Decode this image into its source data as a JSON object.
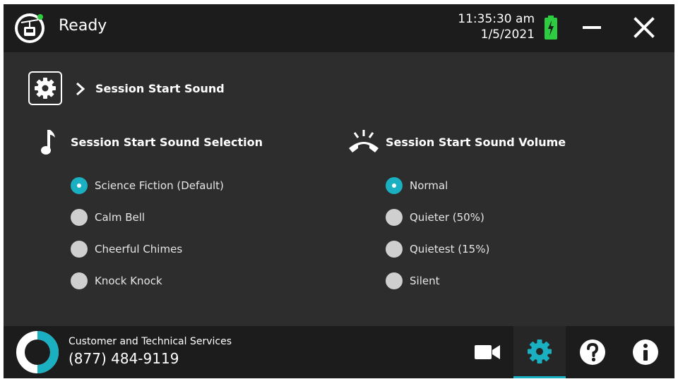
{
  "header": {
    "status": "Ready",
    "time": "11:35:30 am",
    "date": "1/5/2021",
    "battery_icon": "battery-charging-icon"
  },
  "breadcrumb": {
    "title": "Session Start Sound"
  },
  "sound_selection": {
    "title": "Session Start Sound Selection",
    "options": [
      {
        "label": "Science Fiction (Default)",
        "selected": true
      },
      {
        "label": "Calm Bell",
        "selected": false
      },
      {
        "label": "Cheerful Chimes",
        "selected": false
      },
      {
        "label": "Knock Knock",
        "selected": false
      }
    ]
  },
  "sound_volume": {
    "title": "Session Start Sound Volume",
    "options": [
      {
        "label": "Normal",
        "selected": true
      },
      {
        "label": "Quieter (50%)",
        "selected": false
      },
      {
        "label": "Quietest (15%)",
        "selected": false
      },
      {
        "label": "Silent",
        "selected": false
      }
    ]
  },
  "footer": {
    "support_label": "Customer and Technical Services",
    "support_phone": "(877) 484-9119",
    "nav": [
      {
        "icon": "video-camera-icon",
        "active": false
      },
      {
        "icon": "gear-icon",
        "active": true
      },
      {
        "icon": "help-icon",
        "active": false
      },
      {
        "icon": "info-icon",
        "active": false
      }
    ]
  },
  "colors": {
    "accent": "#1ab0c2",
    "battery": "#2ecc40",
    "background": "#2d2d2d",
    "bar": "#1c1c1c"
  }
}
